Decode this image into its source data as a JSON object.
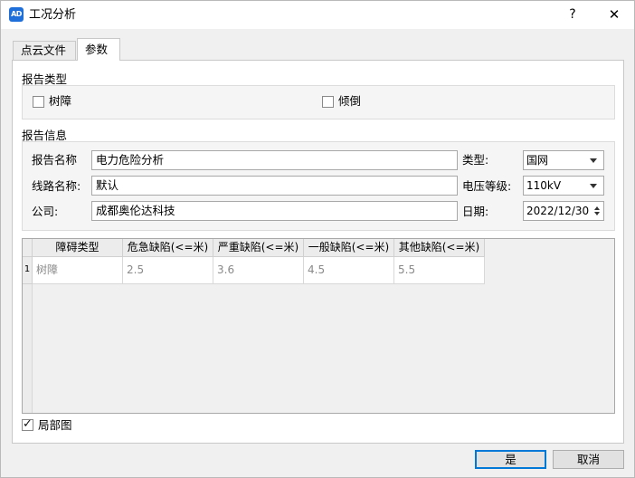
{
  "window": {
    "title": "工况分析",
    "icon_text": "AD",
    "help_label": "?",
    "close_label": "✕"
  },
  "tabs": [
    {
      "label": "点云文件",
      "active": false
    },
    {
      "label": "参数",
      "active": true
    }
  ],
  "report_type": {
    "title": "报告类型",
    "options": [
      {
        "label": "树障",
        "checked": false
      },
      {
        "label": "倾倒",
        "checked": false
      }
    ]
  },
  "report_info": {
    "title": "报告信息",
    "name_label": "报告名称",
    "name_value": "电力危险分析",
    "line_label": "线路名称:",
    "line_value": "默认",
    "company_label": "公司:",
    "company_value": "成都奥伦达科技",
    "type_label": "类型:",
    "type_value": "国网",
    "voltage_label": "电压等级:",
    "voltage_value": "110kV",
    "date_label": "日期:",
    "date_value": "2022/12/30"
  },
  "table": {
    "columns": [
      "障碍类型",
      "危急缺陷(<=米)",
      "严重缺陷(<=米)",
      "一般缺陷(<=米)",
      "其他缺陷(<=米)"
    ],
    "rows": [
      {
        "index": "1",
        "cells": [
          "树障",
          "2.5",
          "3.6",
          "4.5",
          "5.5"
        ]
      }
    ]
  },
  "partial_view": {
    "label": "局部图",
    "checked": true
  },
  "buttons": {
    "ok": "是",
    "cancel": "取消"
  },
  "colors": {
    "accent": "#0078d7",
    "icon_bg": "#1e6fd9"
  }
}
